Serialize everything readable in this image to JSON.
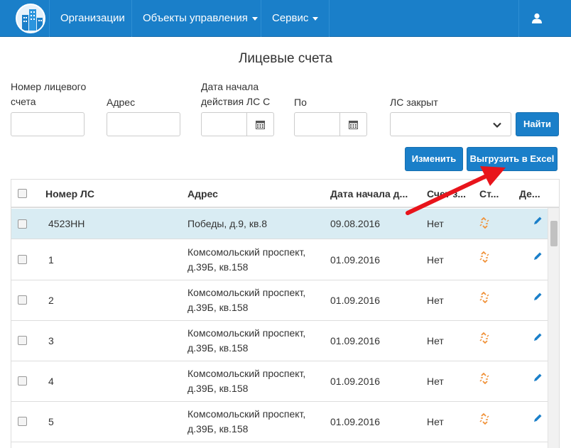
{
  "navbar": {
    "items": [
      {
        "label": "Организации",
        "caret": false
      },
      {
        "label": "Объекты управления",
        "caret": true
      },
      {
        "label": "Сервис",
        "caret": true
      }
    ],
    "user_icon": "user-icon"
  },
  "page": {
    "title": "Лицевые счета"
  },
  "filters": {
    "account_number_label_1": "Номер лицевого",
    "account_number_label_2": "счета",
    "address_label": "Адрес",
    "date_from_label_1": "Дата начала",
    "date_from_label_2": "действия ЛС С",
    "date_to_label": "По",
    "closed_label": "ЛС закрыт",
    "closed_value": "",
    "find_button": "Найти"
  },
  "actions": {
    "edit_button": "Изменить",
    "export_button": "Выгрузить в Excel"
  },
  "table": {
    "headers": [
      "Номер ЛС",
      "Адрес",
      "Дата начала д...",
      "Счет з...",
      "Ст...",
      "Де..."
    ],
    "rows": [
      {
        "number": "4523НН",
        "address1": "Победы, д.9, кв.8",
        "address2": "",
        "date": "09.08.2016",
        "closed": "Нет"
      },
      {
        "number": "1",
        "address1": "Комсомольский проспект,",
        "address2": "д.39Б, кв.158",
        "date": "01.09.2016",
        "closed": "Нет"
      },
      {
        "number": "2",
        "address1": "Комсомольский проспект,",
        "address2": "д.39Б, кв.158",
        "date": "01.09.2016",
        "closed": "Нет"
      },
      {
        "number": "3",
        "address1": "Комсомольский проспект,",
        "address2": "д.39Б, кв.158",
        "date": "01.09.2016",
        "closed": "Нет"
      },
      {
        "number": "4",
        "address1": "Комсомольский проспект,",
        "address2": "д.39Б, кв.158",
        "date": "01.09.2016",
        "closed": "Нет"
      },
      {
        "number": "5",
        "address1": "Комсомольский проспект,",
        "address2": "д.39Б, кв.158",
        "date": "01.09.2016",
        "closed": "Нет"
      }
    ]
  },
  "colors": {
    "primary": "#1a7fc9",
    "selected_row": "#d9ecf3",
    "arrow": "#e8141b",
    "link_icon": "#f0923a"
  }
}
